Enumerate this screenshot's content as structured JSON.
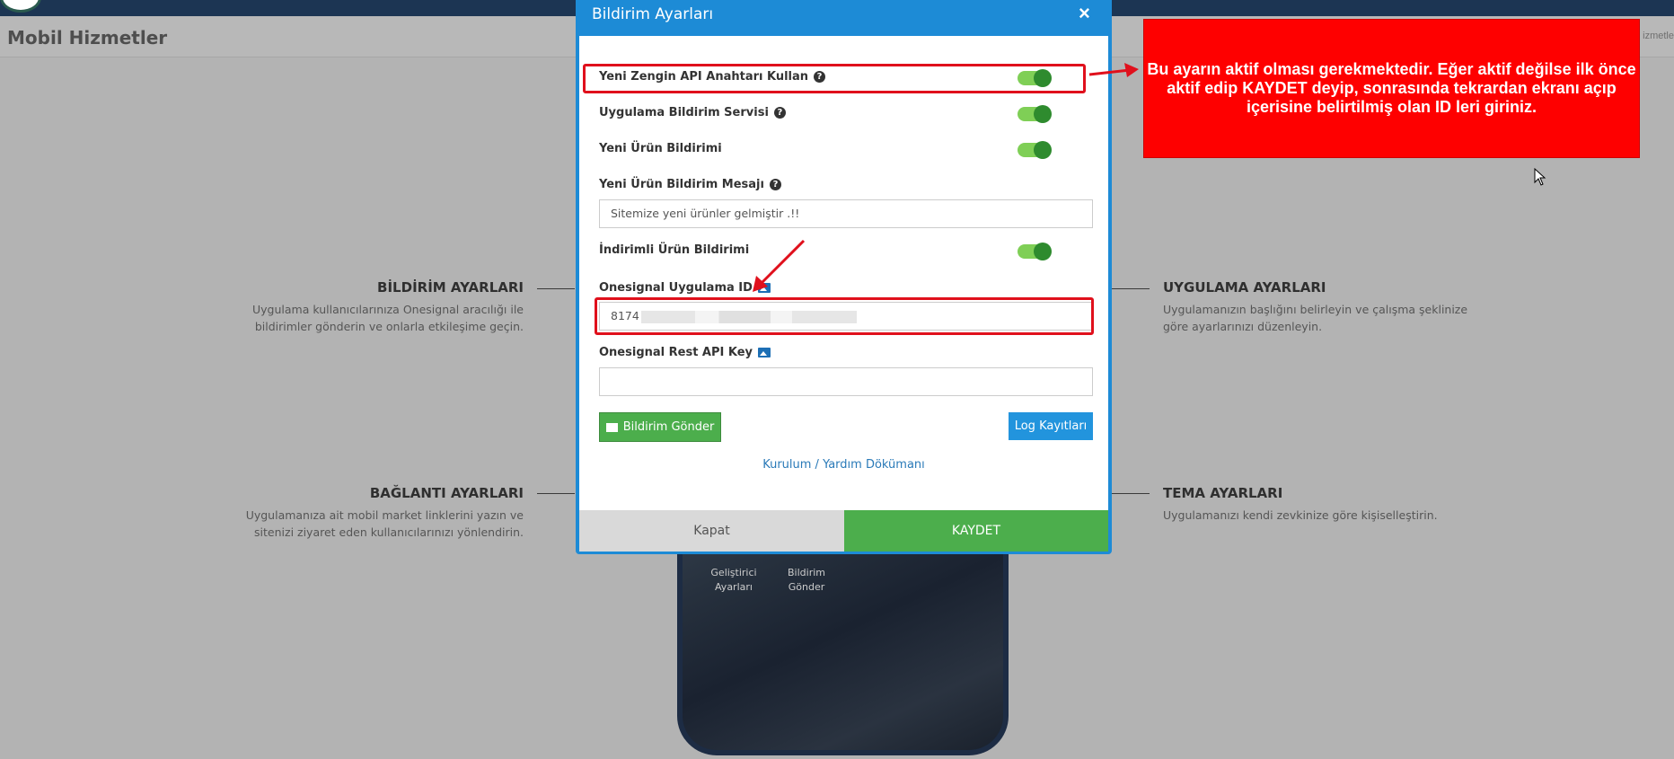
{
  "header": {
    "title": "Mobil Hizmetler",
    "breadcrumb_tail": "izmetle"
  },
  "sections": {
    "bildirim": {
      "title": "BİLDİRİM AYARLARI",
      "desc": "Uygulama kullanıcılarınıza Onesignal aracılığı ile bildirimler gönderin ve onlarla etkileşime geçin."
    },
    "uygulama": {
      "title": "UYGULAMA AYARLARI",
      "desc": "Uygulamanızın başlığını belirleyin ve çalışma şeklinize göre ayarlarınızı düzenleyin."
    },
    "baglanti": {
      "title": "BAĞLANTI AYARLARI",
      "desc": "Uygulamanıza ait mobil market linklerini yazın ve sitenizi ziyaret eden kullanıcılarınızı yönlendirin."
    },
    "tema": {
      "title": "TEMA AYARLARI",
      "desc": "Uygulamanızı kendi zevkinize göre kişiselleştirin."
    }
  },
  "phone": {
    "btn1": "Geliştirici Ayarları",
    "btn2": "Bildirim Gönder"
  },
  "modal": {
    "title": "Bildirim Ayarları",
    "close_symbol": "×",
    "fields": {
      "rich_api": {
        "label": "Yeni Zengin API Anahtarı Kullan",
        "enabled": true
      },
      "app_service": {
        "label": "Uygulama Bildirim Servisi",
        "enabled": true
      },
      "new_product": {
        "label": "Yeni Ürün Bildirimi",
        "enabled": true
      },
      "new_product_msg": {
        "label": "Yeni Ürün Bildirim Mesajı",
        "value": "Sitemize yeni ürünler gelmiştir .!!"
      },
      "discount": {
        "label": "İndirimli Ürün Bildirimi",
        "enabled": true
      },
      "onesignal_app_id": {
        "label": "Onesignal Uygulama ID",
        "value": "8174"
      },
      "onesignal_rest_key": {
        "label": "Onesignal Rest API Key",
        "value": ""
      }
    },
    "send_button": "Bildirim Gönder",
    "log_button": "Log Kayıtları",
    "help_link": "Kurulum / Yardım Dökümanı",
    "footer": {
      "close": "Kapat",
      "save": "KAYDET"
    }
  },
  "annotation": {
    "callout_text": "Bu ayarın aktif olması gerekmektedir. Eğer aktif değilse ilk önce aktif edip KAYDET deyip, sonrasında tekrardan ekranı açıp içerisine belirtilmiş olan ID leri giriniz.",
    "color": "#fe0000"
  },
  "icons": {
    "help": "question-circle-icon",
    "image": "image-icon",
    "envelope": "envelope-icon"
  }
}
